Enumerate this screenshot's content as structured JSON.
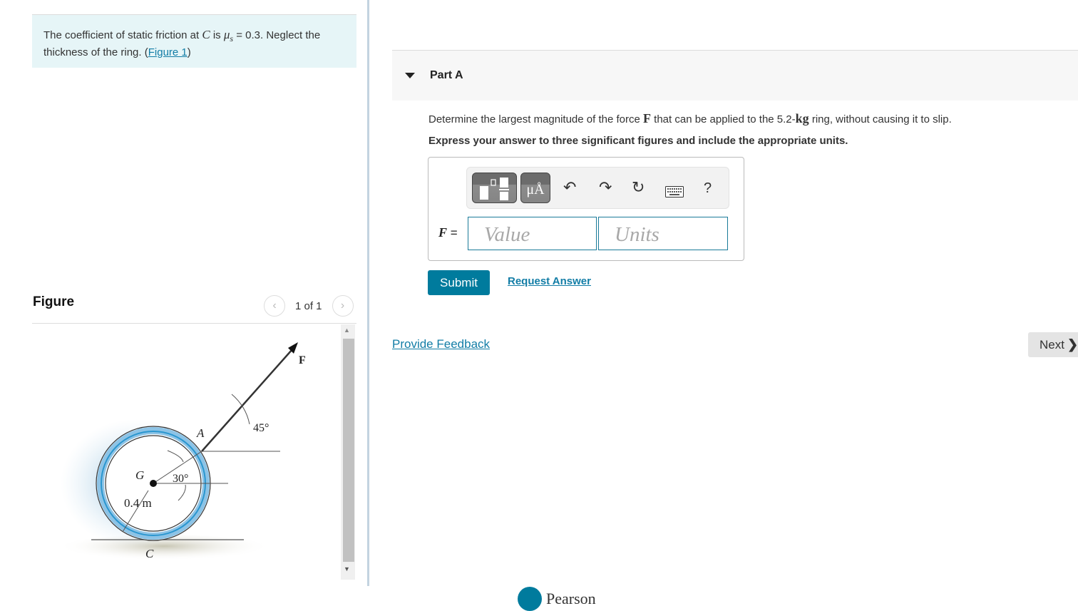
{
  "intro": {
    "text_before": "The coefficient of static friction at ",
    "point": "C",
    "text_is": " is ",
    "mu_symbol": "μ",
    "mu_sub": "s",
    "text_after": " = 0.3. Neglect the thickness of the ring. (",
    "figure_link": "Figure 1",
    "close_paren": ")"
  },
  "figure": {
    "title": "Figure",
    "pager": "1 of 1",
    "labels": {
      "force": "F",
      "point_a": "A",
      "center": "G",
      "contact": "C",
      "angle_force": "45°",
      "angle_a": "30°",
      "radius": "0.4 m"
    }
  },
  "part": {
    "label": "Part A",
    "question_before": "Determine the largest magnitude of the force ",
    "question_force": "F",
    "question_mid": " that can be applied to the 5.2-",
    "question_unit": "kg",
    "question_after": " ring, without causing it to slip.",
    "instruction": "Express your answer to three significant figures and include the appropriate units."
  },
  "answer": {
    "variable": "F",
    "equals": " =",
    "value_placeholder": "Value",
    "units_placeholder": "Units",
    "toolbar": {
      "templates_icon": "fraction-template-icon",
      "units_icon": "μÅ",
      "undo_icon": "↶",
      "redo_icon": "↷",
      "reset_icon": "↻",
      "keyboard_icon": "⌨",
      "help_icon": "?"
    }
  },
  "actions": {
    "submit": "Submit",
    "request_answer": "Request Answer",
    "provide_feedback": "Provide Feedback",
    "next": "Next",
    "next_chevron": "❯"
  },
  "footer": {
    "brand": "Pearson"
  },
  "colors": {
    "accent": "#007b9d",
    "link": "#127da6",
    "intro_bg": "#e6f5f7",
    "ring_blue": "#5aa9d6"
  }
}
